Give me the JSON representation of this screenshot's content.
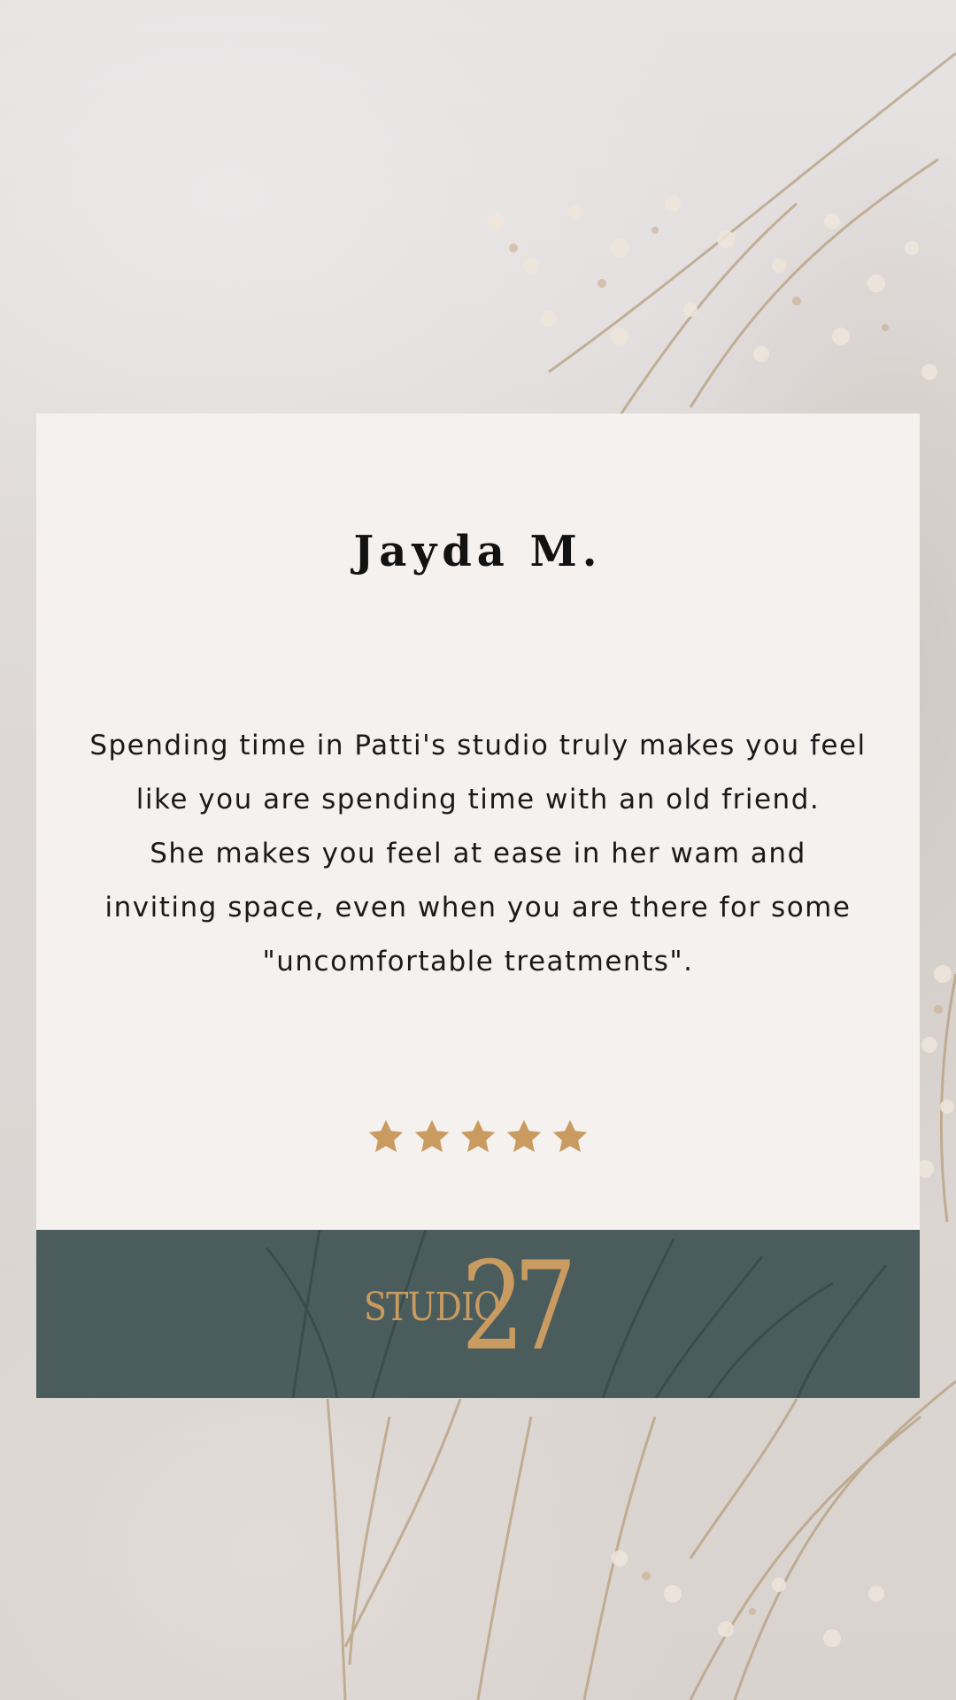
{
  "testimonial": {
    "name": "Jayda M.",
    "quote_lines": [
      "Spending time in Patti's studio truly makes you feel",
      "like you are spending time with an old friend.",
      "She makes you feel at ease in her wam and",
      "inviting space, even when you are there for some",
      "\"uncomfortable treatments\"."
    ],
    "rating": 5,
    "rating_max": 5,
    "star_color": "#c99b61"
  },
  "brand": {
    "word": "STUDIO",
    "number": "27",
    "color": "#c99b61",
    "footer_color": "#3f5353"
  }
}
